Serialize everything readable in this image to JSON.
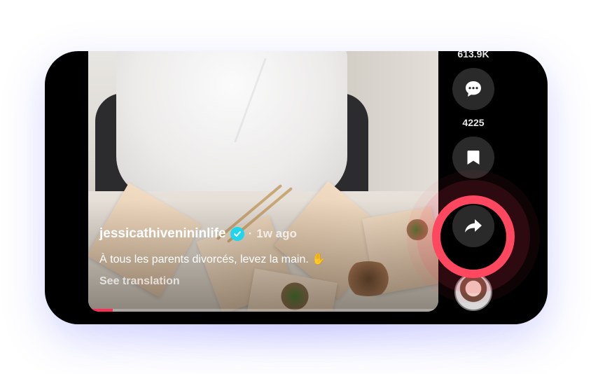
{
  "video": {
    "author": "jessicathivenininlife",
    "separator": "·",
    "time": "1w ago",
    "description": "À tous les parents divorcés, levez la main. ✋",
    "see_translation": "See translation",
    "progress": 0.07
  },
  "actions": {
    "likes": "613.9K",
    "comments": "4225",
    "icons": [
      "comment-icon",
      "bookmark-icon",
      "share-icon"
    ]
  },
  "colors": {
    "accent": "#fe2c55",
    "highlight_ring": "#ff4760",
    "verified": "#20d5ec",
    "action_button": "#2a2a2a"
  }
}
